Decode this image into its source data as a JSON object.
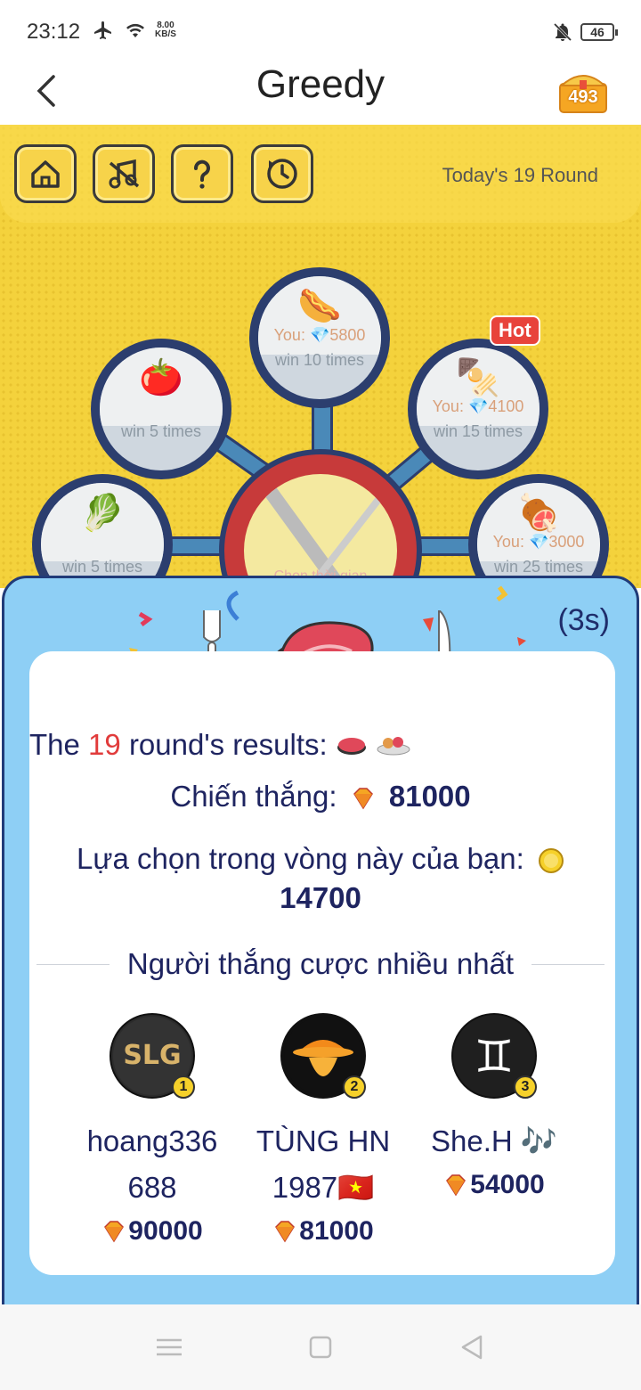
{
  "status_bar": {
    "time": "23:12",
    "net_speed_value": "8.00",
    "net_speed_unit": "KB/S",
    "battery": "46"
  },
  "header": {
    "title": "Greedy",
    "chest_count": "493"
  },
  "game": {
    "round_label": "Today's 19 Round",
    "hot_badge": "Hot",
    "center_text": "Chọn thời gian",
    "items": [
      {
        "food": "tomato",
        "emoji": "🍅",
        "bet_prefix": "",
        "bet": "",
        "win": "win 5 times"
      },
      {
        "food": "hotdog",
        "emoji": "🌭",
        "bet_prefix": "You:",
        "bet": "5800",
        "win": "win 10 times"
      },
      {
        "food": "skewer",
        "emoji": "🍢",
        "bet_prefix": "You:",
        "bet": "4100",
        "win": "win 15 times"
      },
      {
        "food": "cabbage",
        "emoji": "🥬",
        "bet_prefix": "",
        "bet": "",
        "win": "win 5 times"
      },
      {
        "food": "meat-leg",
        "emoji": "🍖",
        "bet_prefix": "You:",
        "bet": "3000",
        "win": "win 25 times"
      }
    ]
  },
  "result": {
    "countdown": "(3s)",
    "results_prefix": "The",
    "round_number": "19",
    "results_suffix": "round's results:",
    "win_label": "Chiến thắng:",
    "win_amount": "81000",
    "choice_label": "Lựa chọn trong vòng này của bạn:",
    "choice_amount": "14700",
    "top_winners_title": "Người thắng cược nhiều nhất",
    "winners": [
      {
        "rank": "1",
        "name": "hoang336 688",
        "amount": "90000",
        "avatar_text": "SLG"
      },
      {
        "rank": "2",
        "name": "TÙNG HN 1987🇻🇳",
        "amount": "81000",
        "avatar_text": ""
      },
      {
        "rank": "3",
        "name": "She.H 🎶",
        "amount": "54000",
        "avatar_text": "♊"
      }
    ]
  },
  "colors": {
    "modal_bg": "#8ecff5",
    "modal_border": "#213b78",
    "game_bg": "#f4d23c",
    "highlight_red": "#e13b3b",
    "text_navy": "#1e2460"
  }
}
